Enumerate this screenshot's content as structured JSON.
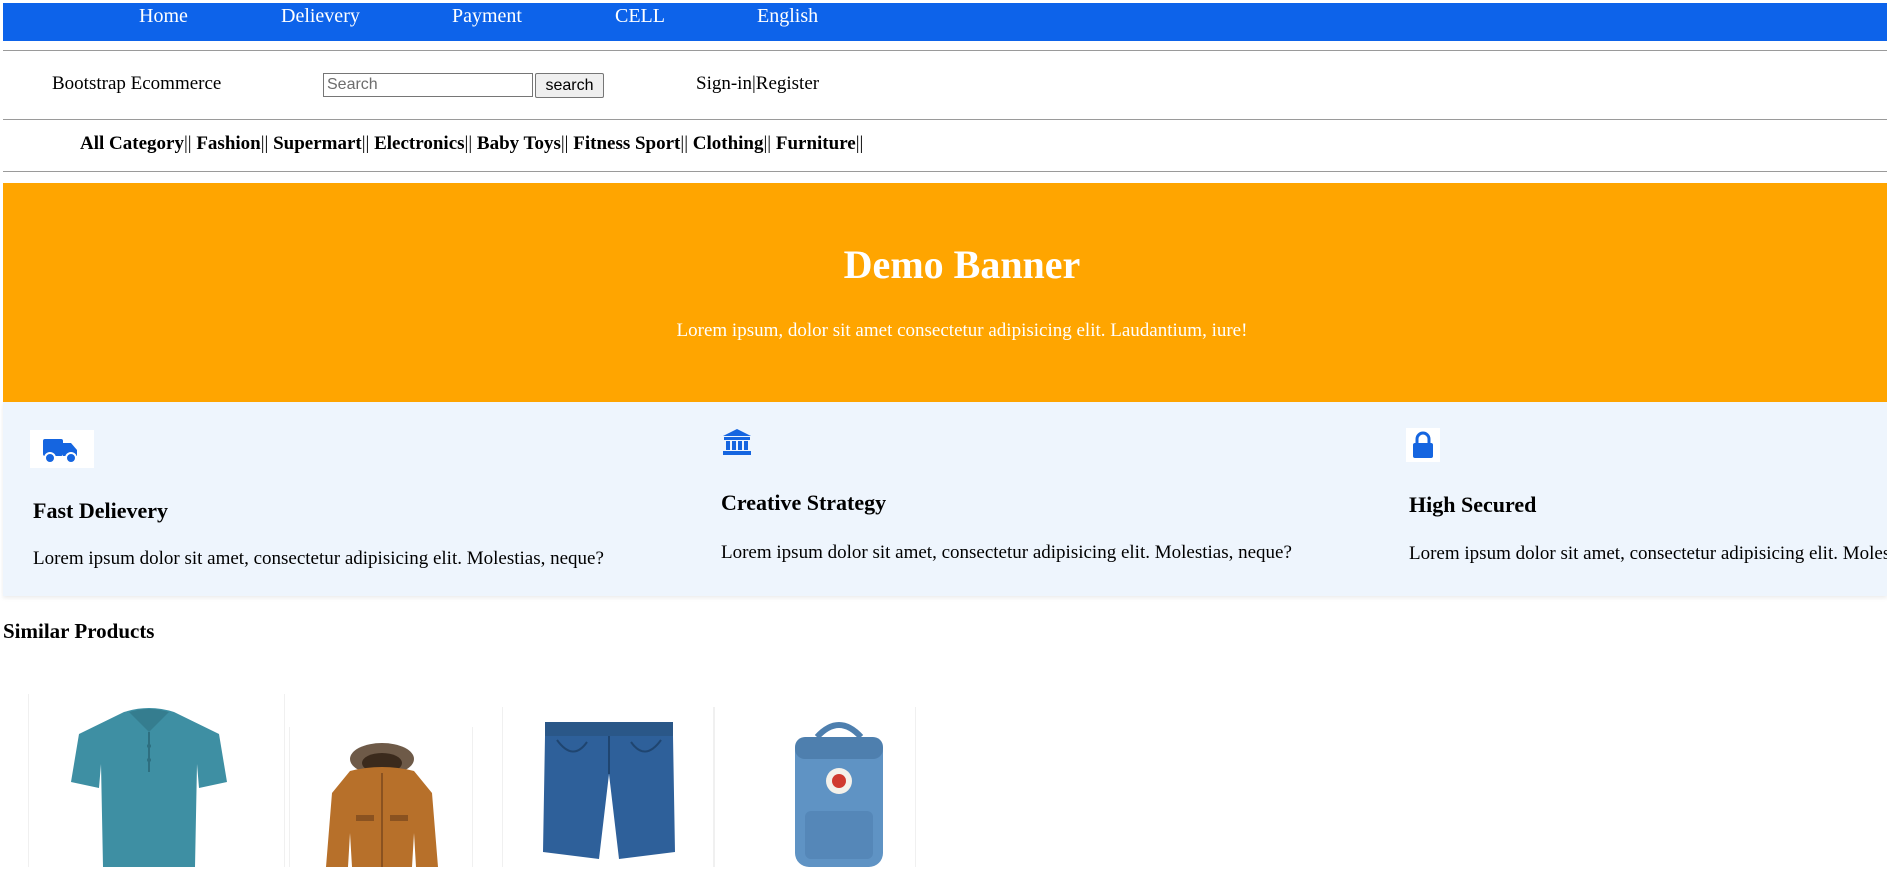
{
  "topnav": {
    "items": [
      {
        "label": "Home"
      },
      {
        "label": "Delievery"
      },
      {
        "label": "Payment"
      },
      {
        "label": "CELL"
      },
      {
        "label": "English"
      }
    ]
  },
  "header": {
    "brand": "Bootstrap Ecommerce",
    "search": {
      "placeholder": "Search",
      "value": "",
      "button_label": "search"
    },
    "sign_in": "Sign-in",
    "divider": "|",
    "register": "Register"
  },
  "categories": {
    "separator": "||",
    "items": [
      "All Category",
      "Fashion",
      "Supermart",
      "Electronics",
      "Baby Toys",
      "Fitness Sport",
      "Clothing",
      "Furniture"
    ]
  },
  "banner": {
    "title": "Demo Banner",
    "subtitle": "Lorem ipsum, dolor sit amet consectetur adipisicing elit. Laudantium, iure!",
    "color": "#ffa500"
  },
  "features": [
    {
      "icon": "truck-icon",
      "title": "Fast Delievery",
      "text": "Lorem ipsum dolor sit amet, consectetur adipisicing elit. Molestias, neque?"
    },
    {
      "icon": "bank-icon",
      "title": "Creative Strategy",
      "text": "Lorem ipsum dolor sit amet, consectetur adipisicing elit. Molestias, neque?"
    },
    {
      "icon": "lock-icon",
      "title": "High Secured",
      "text": "Lorem ipsum dolor sit amet, consectetur adipisicing elit. Molestias, neque?"
    }
  ],
  "similar_products": {
    "heading": "Similar Products",
    "items": [
      {
        "image": "polo-shirt-image"
      },
      {
        "image": "jacket-image"
      },
      {
        "image": "denim-shorts-image"
      },
      {
        "image": "backpack-image"
      }
    ]
  },
  "colors": {
    "nav_blue": "#0d63ea",
    "banner_orange": "#ffa500",
    "features_bg": "#eef5fd",
    "icon_blue": "#1565e0"
  }
}
